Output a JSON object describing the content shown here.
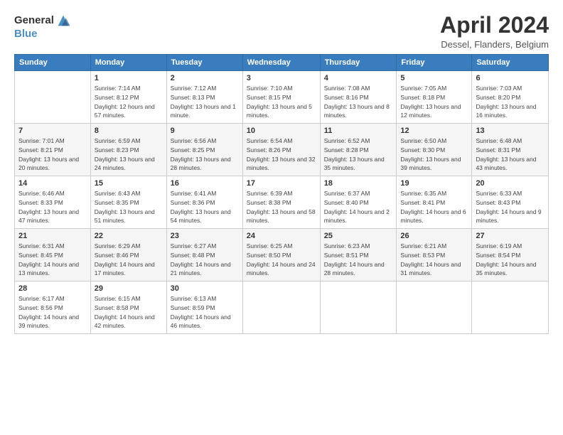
{
  "header": {
    "logo_line1": "General",
    "logo_line2": "Blue",
    "month_title": "April 2024",
    "location": "Dessel, Flanders, Belgium"
  },
  "weekdays": [
    "Sunday",
    "Monday",
    "Tuesday",
    "Wednesday",
    "Thursday",
    "Friday",
    "Saturday"
  ],
  "weeks": [
    [
      {
        "day": "",
        "sunrise": "",
        "sunset": "",
        "daylight": ""
      },
      {
        "day": "1",
        "sunrise": "Sunrise: 7:14 AM",
        "sunset": "Sunset: 8:12 PM",
        "daylight": "Daylight: 12 hours and 57 minutes."
      },
      {
        "day": "2",
        "sunrise": "Sunrise: 7:12 AM",
        "sunset": "Sunset: 8:13 PM",
        "daylight": "Daylight: 13 hours and 1 minute."
      },
      {
        "day": "3",
        "sunrise": "Sunrise: 7:10 AM",
        "sunset": "Sunset: 8:15 PM",
        "daylight": "Daylight: 13 hours and 5 minutes."
      },
      {
        "day": "4",
        "sunrise": "Sunrise: 7:08 AM",
        "sunset": "Sunset: 8:16 PM",
        "daylight": "Daylight: 13 hours and 8 minutes."
      },
      {
        "day": "5",
        "sunrise": "Sunrise: 7:05 AM",
        "sunset": "Sunset: 8:18 PM",
        "daylight": "Daylight: 13 hours and 12 minutes."
      },
      {
        "day": "6",
        "sunrise": "Sunrise: 7:03 AM",
        "sunset": "Sunset: 8:20 PM",
        "daylight": "Daylight: 13 hours and 16 minutes."
      }
    ],
    [
      {
        "day": "7",
        "sunrise": "Sunrise: 7:01 AM",
        "sunset": "Sunset: 8:21 PM",
        "daylight": "Daylight: 13 hours and 20 minutes."
      },
      {
        "day": "8",
        "sunrise": "Sunrise: 6:59 AM",
        "sunset": "Sunset: 8:23 PM",
        "daylight": "Daylight: 13 hours and 24 minutes."
      },
      {
        "day": "9",
        "sunrise": "Sunrise: 6:56 AM",
        "sunset": "Sunset: 8:25 PM",
        "daylight": "Daylight: 13 hours and 28 minutes."
      },
      {
        "day": "10",
        "sunrise": "Sunrise: 6:54 AM",
        "sunset": "Sunset: 8:26 PM",
        "daylight": "Daylight: 13 hours and 32 minutes."
      },
      {
        "day": "11",
        "sunrise": "Sunrise: 6:52 AM",
        "sunset": "Sunset: 8:28 PM",
        "daylight": "Daylight: 13 hours and 35 minutes."
      },
      {
        "day": "12",
        "sunrise": "Sunrise: 6:50 AM",
        "sunset": "Sunset: 8:30 PM",
        "daylight": "Daylight: 13 hours and 39 minutes."
      },
      {
        "day": "13",
        "sunrise": "Sunrise: 6:48 AM",
        "sunset": "Sunset: 8:31 PM",
        "daylight": "Daylight: 13 hours and 43 minutes."
      }
    ],
    [
      {
        "day": "14",
        "sunrise": "Sunrise: 6:46 AM",
        "sunset": "Sunset: 8:33 PM",
        "daylight": "Daylight: 13 hours and 47 minutes."
      },
      {
        "day": "15",
        "sunrise": "Sunrise: 6:43 AM",
        "sunset": "Sunset: 8:35 PM",
        "daylight": "Daylight: 13 hours and 51 minutes."
      },
      {
        "day": "16",
        "sunrise": "Sunrise: 6:41 AM",
        "sunset": "Sunset: 8:36 PM",
        "daylight": "Daylight: 13 hours and 54 minutes."
      },
      {
        "day": "17",
        "sunrise": "Sunrise: 6:39 AM",
        "sunset": "Sunset: 8:38 PM",
        "daylight": "Daylight: 13 hours and 58 minutes."
      },
      {
        "day": "18",
        "sunrise": "Sunrise: 6:37 AM",
        "sunset": "Sunset: 8:40 PM",
        "daylight": "Daylight: 14 hours and 2 minutes."
      },
      {
        "day": "19",
        "sunrise": "Sunrise: 6:35 AM",
        "sunset": "Sunset: 8:41 PM",
        "daylight": "Daylight: 14 hours and 6 minutes."
      },
      {
        "day": "20",
        "sunrise": "Sunrise: 6:33 AM",
        "sunset": "Sunset: 8:43 PM",
        "daylight": "Daylight: 14 hours and 9 minutes."
      }
    ],
    [
      {
        "day": "21",
        "sunrise": "Sunrise: 6:31 AM",
        "sunset": "Sunset: 8:45 PM",
        "daylight": "Daylight: 14 hours and 13 minutes."
      },
      {
        "day": "22",
        "sunrise": "Sunrise: 6:29 AM",
        "sunset": "Sunset: 8:46 PM",
        "daylight": "Daylight: 14 hours and 17 minutes."
      },
      {
        "day": "23",
        "sunrise": "Sunrise: 6:27 AM",
        "sunset": "Sunset: 8:48 PM",
        "daylight": "Daylight: 14 hours and 21 minutes."
      },
      {
        "day": "24",
        "sunrise": "Sunrise: 6:25 AM",
        "sunset": "Sunset: 8:50 PM",
        "daylight": "Daylight: 14 hours and 24 minutes."
      },
      {
        "day": "25",
        "sunrise": "Sunrise: 6:23 AM",
        "sunset": "Sunset: 8:51 PM",
        "daylight": "Daylight: 14 hours and 28 minutes."
      },
      {
        "day": "26",
        "sunrise": "Sunrise: 6:21 AM",
        "sunset": "Sunset: 8:53 PM",
        "daylight": "Daylight: 14 hours and 31 minutes."
      },
      {
        "day": "27",
        "sunrise": "Sunrise: 6:19 AM",
        "sunset": "Sunset: 8:54 PM",
        "daylight": "Daylight: 14 hours and 35 minutes."
      }
    ],
    [
      {
        "day": "28",
        "sunrise": "Sunrise: 6:17 AM",
        "sunset": "Sunset: 8:56 PM",
        "daylight": "Daylight: 14 hours and 39 minutes."
      },
      {
        "day": "29",
        "sunrise": "Sunrise: 6:15 AM",
        "sunset": "Sunset: 8:58 PM",
        "daylight": "Daylight: 14 hours and 42 minutes."
      },
      {
        "day": "30",
        "sunrise": "Sunrise: 6:13 AM",
        "sunset": "Sunset: 8:59 PM",
        "daylight": "Daylight: 14 hours and 46 minutes."
      },
      {
        "day": "",
        "sunrise": "",
        "sunset": "",
        "daylight": ""
      },
      {
        "day": "",
        "sunrise": "",
        "sunset": "",
        "daylight": ""
      },
      {
        "day": "",
        "sunrise": "",
        "sunset": "",
        "daylight": ""
      },
      {
        "day": "",
        "sunrise": "",
        "sunset": "",
        "daylight": ""
      }
    ]
  ]
}
